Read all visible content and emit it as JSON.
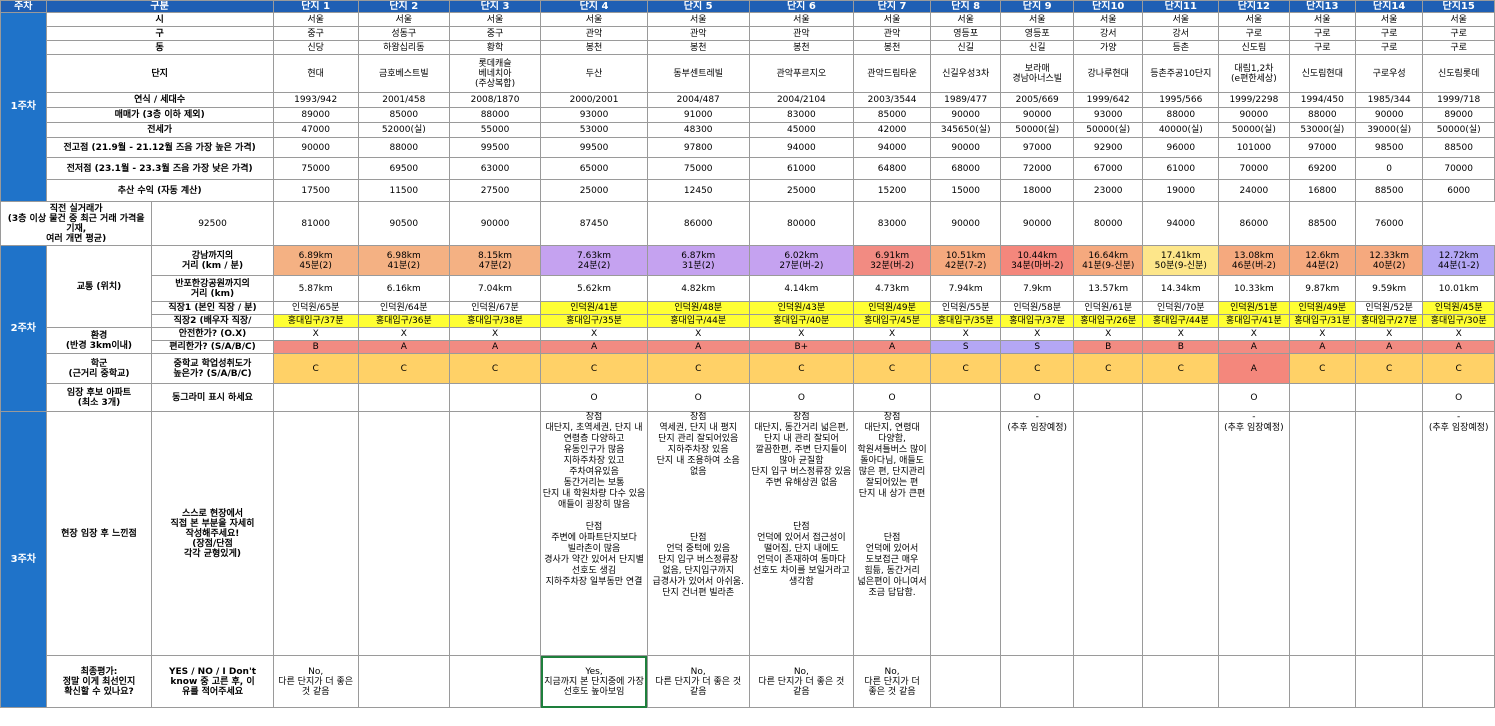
{
  "header": {
    "week": "주차",
    "category": "구분",
    "complexes": [
      "단지 1",
      "단지 2",
      "단지 3",
      "단지 4",
      "단지 5",
      "단지 6",
      "단지 7",
      "단지 8",
      "단지 9",
      "단지10",
      "단지11",
      "단지12",
      "단지13",
      "단지14",
      "단지15"
    ]
  },
  "weeks": {
    "w1": "1주차",
    "w2": "2주차",
    "w3": "3주차"
  },
  "labels": {
    "city": "시",
    "gu": "구",
    "dong": "동",
    "complex": "단지",
    "year": "연식 / 세대수",
    "sale": "매매가 (3층 이하 제외)",
    "rent": "전세가",
    "peak": "전고점 (21.9월 - 21.12월 즈음 가장 높은 가격)",
    "low": "전저점 (23.1월 - 23.3월 즈음 가장 낮은 가격)",
    "profit": "추산 수익 (자동 계산)",
    "recent": "직전 실거래가\n(3층 이상 물건 중 최근 거래 가격을 기재,\n여러 개면 평균)",
    "transport": "교통 (위치)",
    "gangnam": "강남까지의\n거리 (km / 분)",
    "river": "반포한강공원까지의\n거리 (km)",
    "job1": "직장1 (본인 직장 / 분)",
    "job2": "직장2 (배우자 직장/",
    "env": "환경\n(반경 3km이내)",
    "env_safe": "안전한가? (O.X)",
    "env_conv": "편리한가? (S/A/B/C)",
    "school": "학군\n(근거리 중학교)",
    "school_q": "중학교 학업성취도가\n높은가? (S/A/B/C)",
    "visit": "임장 후보 아파트\n(최소 3개)",
    "visit_q": "동그라미 표시 하세요",
    "feel": "현장 임장 후 느낀점",
    "feel_q": "스스로 현장에서\n직접 본 부분을 자세히\n작성해주세요!\n(장점/단점\n각각 균형있게)",
    "final": "최종평가:\n정말 이게 최선인지\n확신할 수 있나요?",
    "final_q": "YES / NO / I Don't\nknow 중 고른 후, 이\n유를 적어주세요"
  },
  "rows": {
    "city": [
      "서울",
      "서울",
      "서울",
      "서울",
      "서울",
      "서울",
      "서울",
      "서울",
      "서울",
      "서울",
      "서울",
      "서울",
      "서울",
      "서울",
      "서울"
    ],
    "gu": [
      "중구",
      "성동구",
      "중구",
      "관악",
      "관악",
      "관악",
      "관악",
      "영등포",
      "영등포",
      "강서",
      "강서",
      "구로",
      "구로",
      "구로",
      "구로"
    ],
    "dong": [
      "신당",
      "하왕십리동",
      "황학",
      "봉천",
      "봉천",
      "봉천",
      "봉천",
      "신길",
      "신길",
      "가양",
      "등촌",
      "신도림",
      "구로",
      "구로",
      "구로"
    ],
    "complex": [
      "현대",
      "금호베스트빌",
      "롯데캐슬\n베네치아\n(주상복합)",
      "두산",
      "동부센트레빌",
      "관악푸르지오",
      "관악드림타운",
      "신길우성3차",
      "보라매\n경남아너스빌",
      "강나루현대",
      "등촌주공10단지",
      "대림1,2차\n(e편한세상)",
      "신도림현대",
      "구로우성",
      "신도림롯데"
    ],
    "year": [
      "1993/942",
      "2001/458",
      "2008/1870",
      "2000/2001",
      "2004/487",
      "2004/2104",
      "2003/3544",
      "1989/477",
      "2005/669",
      "1999/642",
      "1995/566",
      "1999/2298",
      "1994/450",
      "1985/344",
      "1999/718"
    ],
    "sale": [
      "89000",
      "85000",
      "88000",
      "93000",
      "91000",
      "83000",
      "85000",
      "90000",
      "90000",
      "93000",
      "88000",
      "90000",
      "88000",
      "90000",
      "89000"
    ],
    "rent": [
      "47000",
      "52000(실)",
      "55000",
      "53000",
      "48300",
      "45000",
      "42000",
      "345650(실)",
      "50000(실)",
      "50000(실)",
      "40000(실)",
      "50000(실)",
      "53000(실)",
      "39000(실)",
      "50000(실)"
    ],
    "peak": [
      "90000",
      "88000",
      "99500",
      "99500",
      "97800",
      "94000",
      "94000",
      "90000",
      "97000",
      "92900",
      "96000",
      "101000",
      "97000",
      "98500",
      "88500"
    ],
    "low": [
      "75000",
      "69500",
      "63000",
      "65000",
      "75000",
      "61000",
      "64800",
      "68000",
      "72000",
      "67000",
      "61000",
      "70000",
      "69200",
      "0",
      "70000"
    ],
    "profit": [
      "17500",
      "11500",
      "27500",
      "25000",
      "12450",
      "25000",
      "15200",
      "15000",
      "18000",
      "23000",
      "19000",
      "24000",
      "16800",
      "88500",
      "6000"
    ],
    "recent": [
      "92500",
      "81000",
      "90500",
      "90000",
      "87450",
      "86000",
      "80000",
      "83000",
      "90000",
      "90000",
      "80000",
      "94000",
      "86000",
      "88500",
      "76000"
    ],
    "gangnam": [
      "6.89km\n45분(2)",
      "6.98km\n41분(2)",
      "8.15km\n47분(2)",
      "7.63km\n24분(2)",
      "6.87km\n31분(2)",
      "6.02km\n27분(버-2)",
      "6.91km\n32분(버-2)",
      "10.51km\n42분(7-2)",
      "10.44km\n34분(마버-2)",
      "16.64km\n41분(9-신분)",
      "17.41km\n50분(9-신분)",
      "13.08km\n46분(버-2)",
      "12.6km\n44분(2)",
      "12.33km\n40분(2)",
      "12.72km\n44분(1-2)"
    ],
    "river": [
      "5.87km",
      "6.16km",
      "7.04km",
      "5.62km",
      "4.82km",
      "4.14km",
      "4.73km",
      "7.94km",
      "7.9km",
      "13.57km",
      "14.34km",
      "10.33km",
      "9.87km",
      "9.59km",
      "10.01km"
    ],
    "job1": [
      "인덕원/65분",
      "인덕원/64분",
      "인덕원/67분",
      "인덕원/41분",
      "인덕원/48분",
      "인덕원/43분",
      "인덕원/49분",
      "인덕원/55분",
      "인덕원/58분",
      "인덕원/61분",
      "인덕원/70분",
      "인덕원/51분",
      "인덕원/49분",
      "인덕원/52분",
      "인덕원/45분"
    ],
    "job2": [
      "홍대입구/37분",
      "홍대입구/36분",
      "홍대입구/38분",
      "홍대입구/35분",
      "홍대입구/44분",
      "홍대입구/40분",
      "홍대입구/45분",
      "홍대입구/35분",
      "홍대입구/37분",
      "홍대입구/26분",
      "홍대입구/44분",
      "홍대입구/41분",
      "홍대입구/31분",
      "홍대입구/27분",
      "홍대입구/30분"
    ],
    "safe": [
      "X",
      "X",
      "X",
      "X",
      "X",
      "X",
      "X",
      "X",
      "X",
      "X",
      "X",
      "X",
      "X",
      "X",
      "X"
    ],
    "conv": [
      "B",
      "A",
      "A",
      "A",
      "A",
      "B+",
      "A",
      "S",
      "S",
      "B",
      "B",
      "A",
      "A",
      "A",
      "A"
    ],
    "school": [
      "C",
      "C",
      "C",
      "C",
      "C",
      "C",
      "C",
      "C",
      "C",
      "C",
      "C",
      "A",
      "C",
      "C",
      "C"
    ],
    "visit": [
      "",
      "",
      "",
      "O",
      "O",
      "O",
      "O",
      "",
      "O",
      "",
      "",
      "O",
      "",
      "",
      "O"
    ],
    "feel": [
      "",
      "",
      "",
      "장점\n대단지, 초역세권, 단지 내 연령층 다양하고 유동인구가 많음\n지하주차장 있고 주차여유있음\n동간거리는 보통\n단지 내 학원차량 다수 있음\n애들이 굉장히 많음\n\n단점\n주변에 아파트단지보다 빌라촌이 많음\n경사가 약간 있어서 단지별 선호도 생김\n지하주차장 일부동만 연결",
      "장점\n역세권, 단지 내 평지\n단지 관리 잘되어있음\n지하주차장 있음\n단지 내 조용하여 소음 없음\n\n\n\n\n\n단점\n언덕 중턱에 있음\n단지 입구 버스정류장 없음, 단지입구까지 급경사가 있어서 아쉬움. 단지 건너편 빌라촌",
      "장점\n대단지, 동간거리 넓은편, 단지 내 관리 잘되어 깔끔한편, 주변 단지들이 많아 균질함\n단지 입구 버스정류장 있음\n주변 유해상권 없음\n\n\n\n단점\n언덕에 있어서 접근성이 떨어짐, 단지 내에도 언덕이 존재하여 동마다 선호도 차이를 보일거라고 생각함",
      "장점\n대단지, 연령대 다양함, 학원셔틀버스 많이 돌아다님, 애들도 많은 편, 단지관리 잘되어있는 편\n단지 내 상가 큰편\n\n\n\n단점\n언덕에 있어서 도보접근 매우 힘듦, 동간거리 넓은편이 아니여서 조금 답답함.",
      "",
      "-\n(추후 임장예정)",
      "",
      "",
      "-\n(추후 임장예정)",
      "",
      "",
      "-\n(추후 임장예정)"
    ],
    "final": [
      "No,\n다른 단지가 더 좋은 것 같음",
      "",
      "",
      "Yes,\n지금까지 본 단지중에 가장 선호도 높아보임",
      "No,\n다른 단지가 더 좋은 것 같음",
      "No,\n다른 단지가 더 좋은 것 같음",
      "No,\n다른 단지가 더 좋은 것 같음",
      "",
      "",
      "",
      "",
      "",
      "",
      "",
      ""
    ]
  },
  "colors": {
    "header": "#1f5fb4",
    "orange": "#f4b183",
    "purple": "#c5a2f0",
    "red": "#f28b82",
    "yellow": "#fde68a",
    "job_yellow": "#ffff33",
    "school_gold": "#ffd167",
    "school_pink": "#f4877c"
  }
}
